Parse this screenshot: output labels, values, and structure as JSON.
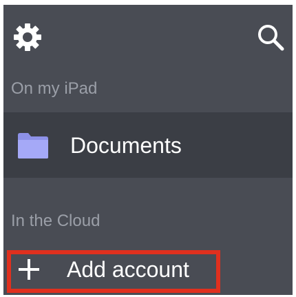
{
  "toolbar": {
    "settings_icon": "gear-icon",
    "search_icon": "search-icon"
  },
  "sections": {
    "local": {
      "header": "On my iPad",
      "items": [
        {
          "label": "Documents",
          "icon": "folder-icon",
          "icon_color": "#a5a9f7",
          "selected": true
        }
      ]
    },
    "cloud": {
      "header": "In the Cloud",
      "add_account_label": "Add account",
      "add_icon": "plus-icon"
    }
  },
  "colors": {
    "panel_background": "#494c54",
    "selected_row": "#3b3e45",
    "section_header_text": "#9b9fa8",
    "primary_text": "#ffffff",
    "highlight_outline": "#e0301e"
  }
}
